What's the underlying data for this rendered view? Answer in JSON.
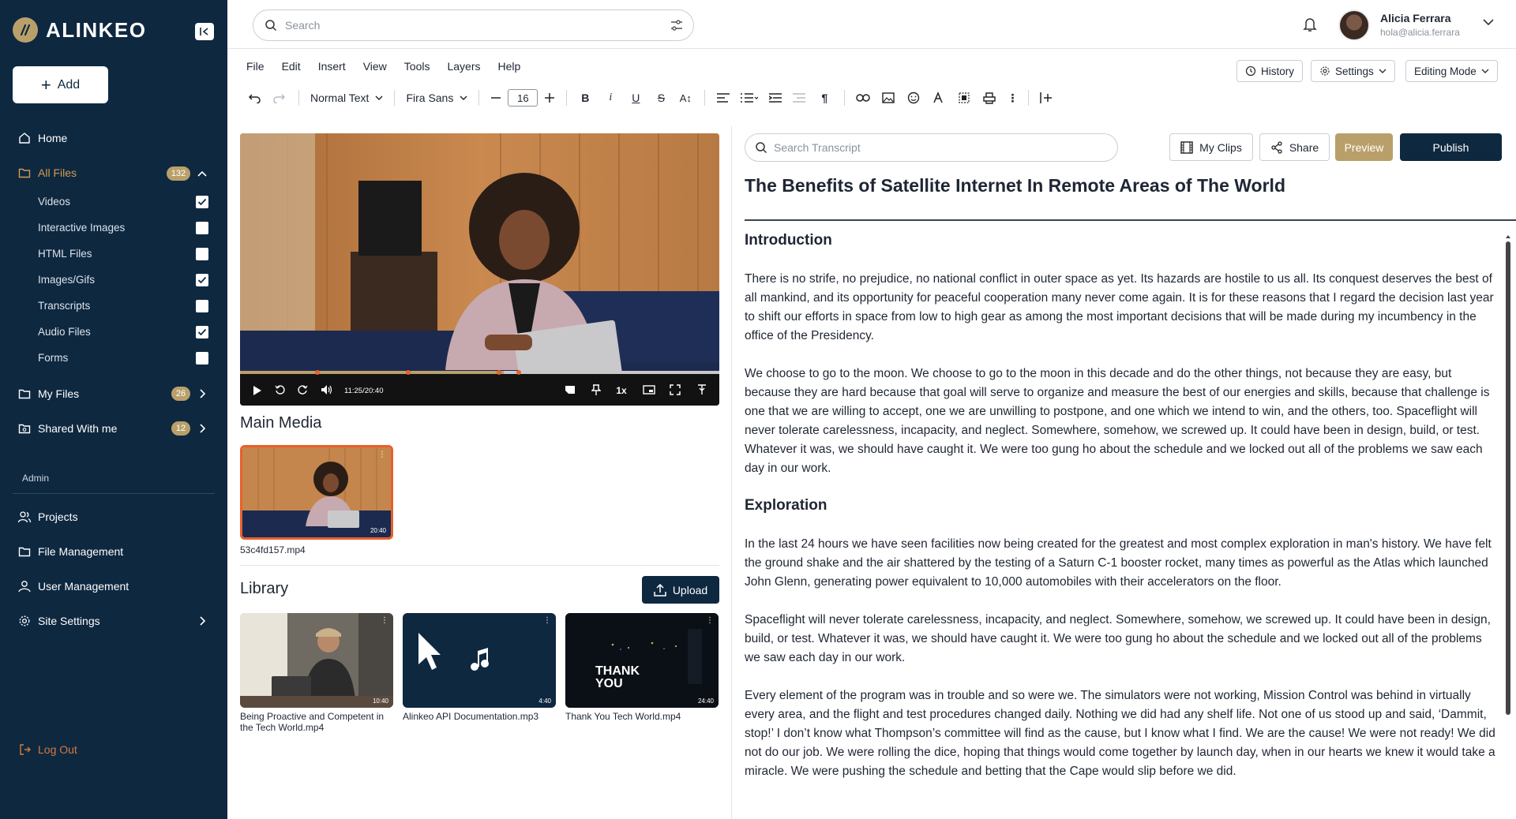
{
  "brand": {
    "name": "ALINKEO",
    "brand_color": "#b9a06a",
    "sidebar_bg": "#0e2840"
  },
  "sidebar": {
    "add_label": "Add",
    "items": [
      {
        "label": "Home",
        "icon": "home-icon"
      },
      {
        "label": "All Files",
        "icon": "folder-icon",
        "count": "132"
      },
      {
        "label": "My Files",
        "icon": "folder-icon",
        "count": "26"
      },
      {
        "label": "Shared With me",
        "icon": "folder-shared-icon",
        "count": "12"
      }
    ],
    "file_types": [
      {
        "label": "Videos",
        "checked": true
      },
      {
        "label": "Interactive Images",
        "checked": false
      },
      {
        "label": "HTML Files",
        "checked": false
      },
      {
        "label": "Images/Gifs",
        "checked": true
      },
      {
        "label": "Transcripts",
        "checked": false
      },
      {
        "label": "Audio Files",
        "checked": true
      },
      {
        "label": "Forms",
        "checked": false
      }
    ],
    "admin_label": "Admin",
    "admin_items": [
      {
        "label": "Projects",
        "icon": "users-icon"
      },
      {
        "label": "File Management",
        "icon": "folder-icon"
      },
      {
        "label": "User Management",
        "icon": "user-icon"
      },
      {
        "label": "Site Settings",
        "icon": "gear-icon"
      }
    ],
    "logout_label": "Log Out"
  },
  "topbar": {
    "search_placeholder": "Search",
    "user_name": "Alicia Ferrara",
    "user_email": "hola@alicia.ferrara"
  },
  "menu": [
    "File",
    "Edit",
    "Insert",
    "View",
    "Tools",
    "Layers",
    "Help"
  ],
  "top_buttons": {
    "history": "History",
    "settings": "Settings",
    "mode": "Editing Mode"
  },
  "toolbar": {
    "text_style": "Normal Text",
    "font": "Fira Sans",
    "font_size": "16"
  },
  "player": {
    "time": "11:25/20:40",
    "speed": "1x",
    "progress": 0.55,
    "accent": "#e8602c"
  },
  "main_media": {
    "title": "Main Media",
    "duration": "20:40",
    "file": "53c4fd157.mp4"
  },
  "library": {
    "title": "Library",
    "upload_label": "Upload",
    "items": [
      {
        "name": "Being Proactive and Competent in the Tech World.mp4",
        "duration": "10:40"
      },
      {
        "name": "Alinkeo API Documentation.mp3",
        "duration": "4:40"
      },
      {
        "name": "Thank You Tech World.mp4",
        "duration": "24:40",
        "overlay": "THANK YOU"
      }
    ]
  },
  "transcript": {
    "search_placeholder": "Search Transcript",
    "my_clips": "My Clips",
    "share": "Share",
    "preview": "Preview",
    "publish": "Publish",
    "title": "The Benefits of Satellite Internet In Remote Areas of The World",
    "h_intro": "Introduction",
    "p1": "There is no strife, no prejudice, no national conflict in outer space as yet. Its hazards are hostile to us all. Its conquest deserves the best of all mankind, and its opportunity for peaceful cooperation many never come again. It is for these reasons that I regard the decision last year to shift our efforts in space from low to high gear as among the most important decisions that will be made during my incumbency in the office of the Presidency.",
    "p2": "We choose to go to the moon. We choose to go to the moon in this decade and do the other things, not because they are easy, but because they are hard because that goal will serve to organize and measure the best of our energies and skills, because that challenge is one that we are willing to accept, one we are unwilling to postpone, and one which we intend to win, and the others, too. Spaceflight will never tolerate carelessness, incapacity, and neglect. Somewhere, somehow, we screwed up. It could have been in design, build, or test. Whatever it was, we should have caught it. We were too gung ho about the schedule and we locked out all of the problems we saw each day in our work.",
    "h_explore": "Exploration",
    "p3": "In the last 24 hours we have seen facilities now being created for the greatest and most complex exploration in man's history. We have felt the ground shake and the air shattered by the testing of a Saturn C-1 booster rocket, many times as powerful as the Atlas which launched John Glenn, generating power equivalent to 10,000 automobiles with their accelerators on the floor.",
    "p4": "Spaceflight will never tolerate carelessness, incapacity, and neglect. Somewhere, somehow, we screwed up. It could have been in design, build, or test. Whatever it was, we should have caught it. We were too gung ho about the schedule and we locked out all of the problems we saw each day in our work.",
    "p5": "Every element of the program was in trouble and so were we. The simulators were not working, Mission Control was behind in virtually every area, and the flight and test procedures changed daily. Nothing we did had any shelf life. Not one of us stood up and said, ‘Dammit, stop!’ I don’t know what Thompson’s committee will find as the cause, but I know what I find. We are the cause! We were not ready! We did not do our job. We were rolling the dice, hoping that things would come together by launch day, when in our hearts we knew it would take a miracle. We were pushing the schedule and betting that the Cape would slip before we did."
  }
}
